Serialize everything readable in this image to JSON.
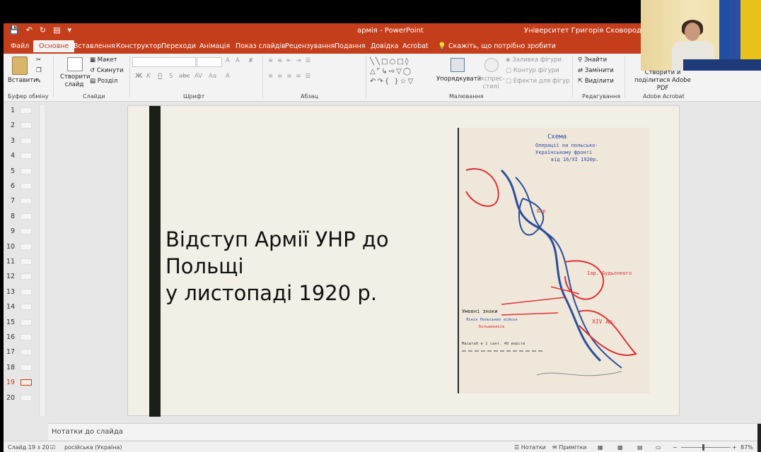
{
  "window": {
    "doc_title": "армія  -  PowerPoint",
    "org": "Університет Григорія Сковороди в Переяславі"
  },
  "colors": {
    "accent": "#c43e1c",
    "ribbon_bg": "#f3f3f3",
    "slide_bar": "#1b1f19"
  },
  "tabs": [
    "Файл",
    "Основне",
    "Вставлення",
    "Конструктор",
    "Переходи",
    "Анімація",
    "Показ слайдів",
    "Рецензування",
    "Подання",
    "Довідка",
    "Acrobat"
  ],
  "active_tab": "Основне",
  "tell_me": "Скажіть, що потрібно зробити",
  "ribbon": {
    "clipboard": {
      "paste": "Вставити",
      "group": "Буфер обміну"
    },
    "slides": {
      "new_slide": "Створити слайд",
      "layout": "Макет",
      "reset": "Скинути",
      "section": "Розділ",
      "group": "Слайди"
    },
    "font": {
      "group": "Шрифт",
      "size_up": "A",
      "size_down": "A",
      "bold": "Ж",
      "italic": "К",
      "underline": "П",
      "shadow": "S",
      "strike": "abc",
      "spacing": "AV",
      "case": "Aa"
    },
    "paragraph": {
      "group": "Абзац"
    },
    "drawing": {
      "arrange": "Упорядкувати",
      "quick_styles": "Експрес-стилі",
      "fill": "Заливка фігури",
      "outline": "Контур фігури",
      "effects": "Ефекти для фігур",
      "group": "Малювання"
    },
    "editing": {
      "find": "Знайти",
      "replace": "Замінити",
      "select": "Виділити",
      "group": "Редагування"
    },
    "acrobat": {
      "create_pdf": "Створити й поділитися Adobe PDF",
      "group": "Adobe Acrobat"
    }
  },
  "thumbnails": {
    "count": 20,
    "active": 19,
    "numbers": [
      "1",
      "2",
      "3",
      "4",
      "5",
      "6",
      "7",
      "8",
      "9",
      "10",
      "11",
      "12",
      "13",
      "14",
      "15",
      "16",
      "17",
      "18",
      "19",
      "20"
    ]
  },
  "slide": {
    "title_line1": "Відступ Армії УНР до Польщі",
    "title_line2": "у листопаді 1920 р.",
    "map": {
      "heading": "Схема",
      "subtitle_1": "Операції на польсько-",
      "subtitle_2": "Українському фронті",
      "subtitle_3": "від 16/XI 1920р.",
      "legend_title": "Умовні знаки",
      "legend_line_1": "Лінія Польських військ",
      "legend_line_2": "Большевиків",
      "scale": "Масштаб в 1 сант. 40 верств",
      "labels": [
        "Iар. Будьонного",
        "XIV Ар.",
        "Бар"
      ]
    }
  },
  "notes_placeholder": "Нотатки до слайда",
  "status": {
    "slide_counter": "Слайд 19 з 20",
    "language": "російська (Україна)",
    "notes": "Нотатки",
    "comments": "Примітки",
    "zoom": "87%"
  }
}
